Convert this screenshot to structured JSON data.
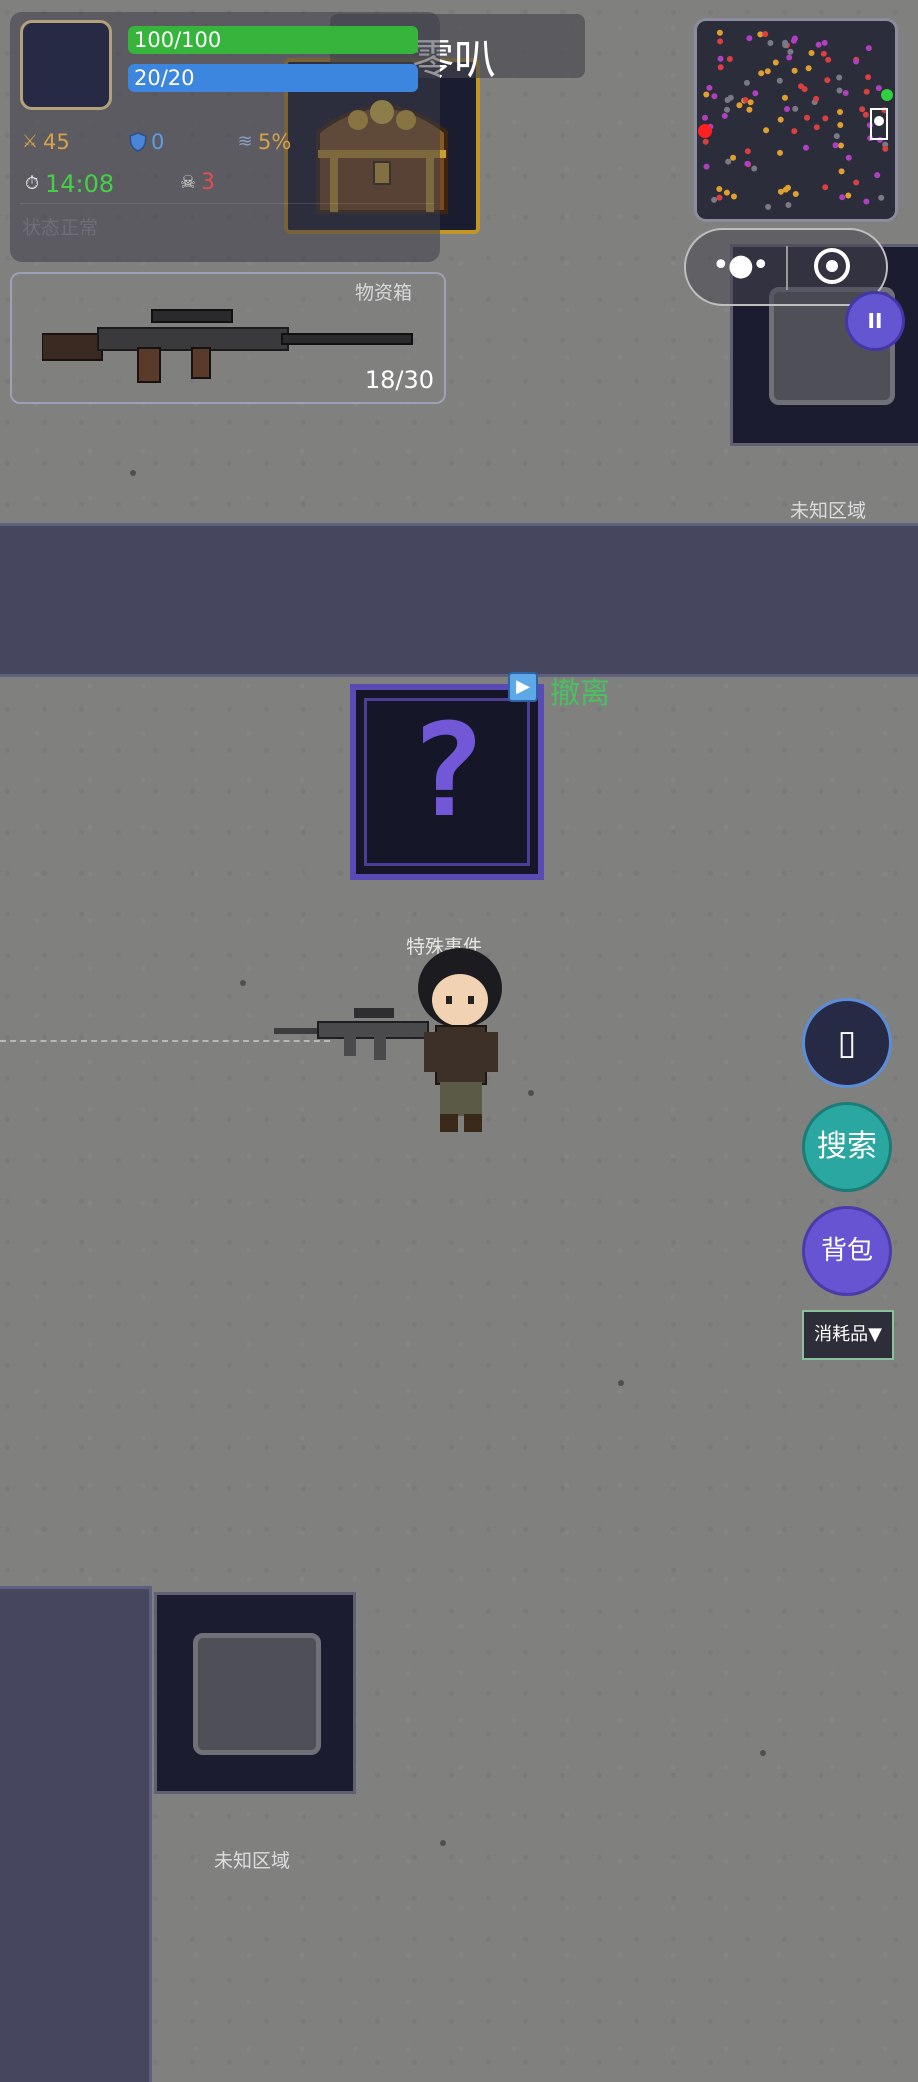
{
  "player": {
    "name": "零叭",
    "hp_text": "100/100",
    "hp_fraction": 1.0,
    "mp_text": "20/20",
    "mp_fraction": 1.0,
    "attack": "45",
    "defense": "0",
    "dodge": "5%",
    "timer": "14:08",
    "kills": "3",
    "state": "状态正常"
  },
  "weapon": {
    "label": "物资箱",
    "ammo": "18/30"
  },
  "map": {
    "unknown_area_top": "未知区域",
    "unknown_area_bottom": "未知区域",
    "event_label": "特殊事件",
    "evac_label": "撤离",
    "mystery_symbol": "?"
  },
  "actions": {
    "blank_glyph": "▯",
    "search": "搜索",
    "bag": "背包",
    "consumables": "消耗品▼",
    "pause": "II"
  },
  "colors": {
    "hp": "#36b43c",
    "mp": "#3d86e0",
    "evac": "#4ac060",
    "timer": "#46d046",
    "kills": "#e05050"
  },
  "icons": [
    "swords-icon",
    "shield-icon",
    "dodge-icon",
    "stopwatch-icon",
    "skull-icon",
    "more-icon",
    "target-icon",
    "pause-icon",
    "play-icon"
  ]
}
